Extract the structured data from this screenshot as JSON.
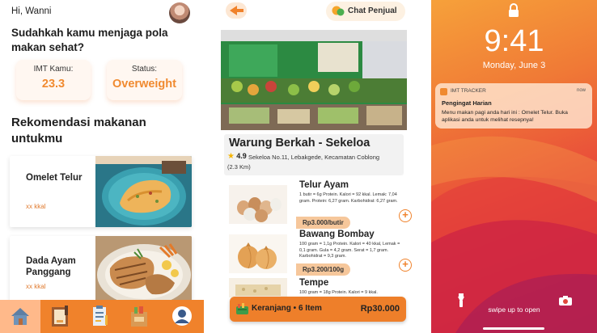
{
  "panel1": {
    "greeting": "Hi, Wanni",
    "question": "Sudahkah kamu menjaga pola makan sehat?",
    "imt": {
      "label": "IMT Kamu:",
      "value": "23.3"
    },
    "status": {
      "label": "Status:",
      "value": "Overweight"
    },
    "recommendation_title": "Rekomendasi makanan untukmu",
    "foods": [
      {
        "name": "Omelet Telur",
        "kkal": "xx kkal"
      },
      {
        "name": "Dada Ayam Panggang",
        "kkal": "xx kkal"
      }
    ],
    "nav": [
      "home-icon",
      "recipe-book-icon",
      "checklist-icon",
      "grocery-bag-icon",
      "profile-icon"
    ],
    "colors": {
      "accent": "#f08a30",
      "navbar": "#f0822b",
      "nav_active": "#ffb98a"
    }
  },
  "panel2": {
    "chat_label": "Chat Penjual",
    "shop": {
      "name": "Warung Berkah - Sekeloa",
      "rating": "4.9",
      "address": "Sekeloa No.11, Lebakgede, Kecamatan Coblong",
      "distance": "(2.3 Km)"
    },
    "items": [
      {
        "name": "Telur Ayam",
        "desc": "1 butir = 6g Protein. Kalori = 92 kkal. Lemak: 7,04 gram. Protein: 6,27 gram. Karbohidrat: 6,27 gram.",
        "price": "Rp3.000/butir"
      },
      {
        "name": "Bawang Bombay",
        "desc": "100 gram = 1,1g Protein. Kalori = 40 kkal, Lemak = 0,1 gram. Gula = 4,2 gram. Serat = 1,7 gram. Karbohidrat = 9,3 gram.",
        "price": "Rp3.200/100g"
      },
      {
        "name": "Tempe",
        "desc": "100 gram = 18g Protein. Kalori = 9 kkal."
      }
    ],
    "cart": {
      "label": "Keranjang • 6 Item",
      "total": "Rp30.000"
    }
  },
  "panel3": {
    "time": "9:41",
    "date": "Monday, June 3",
    "notification": {
      "app": "IMT TRACKER",
      "when": "now",
      "title": "Pengingat Harian",
      "body": "Menu makan pagi anda hari ini : Omelet Telur. Buka aplikasi anda untuk melihat resepnya!"
    },
    "swipe_hint": "swipe up to open"
  }
}
